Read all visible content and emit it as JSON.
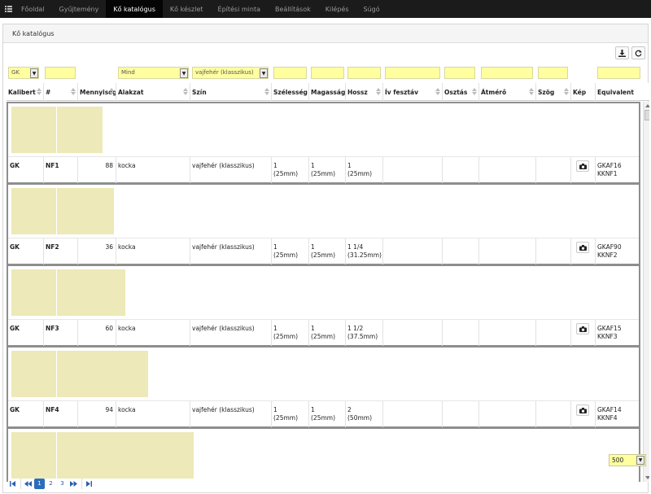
{
  "nav": {
    "items": [
      {
        "label": "Főoldal",
        "active": false
      },
      {
        "label": "Gyűjtemény",
        "active": false
      },
      {
        "label": "Kő katalógus",
        "active": true
      },
      {
        "label": "Kő készlet",
        "active": false
      },
      {
        "label": "Építési minta",
        "active": false
      },
      {
        "label": "Beállítások",
        "active": false
      },
      {
        "label": "Kilépés",
        "active": false
      },
      {
        "label": "Súgó",
        "active": false
      }
    ]
  },
  "panel": {
    "title": "Kő katalógus"
  },
  "filters": {
    "kalibert": "GK",
    "alakzat": "Mind",
    "szin": "vajfehér (klasszikus)"
  },
  "columns": [
    "Kalibert",
    "#",
    "Mennyiség",
    "Alakzat",
    "Szín",
    "Szélesség",
    "Magasság",
    "Hossz",
    "Ív fesztáv",
    "Osztás",
    "Átmérő",
    "Szög",
    "Kép",
    "Equivalent"
  ],
  "rows": [
    {
      "kalibert": "GK",
      "num": "NF1",
      "qty": "88",
      "shape": "kocka",
      "color": "vajfehér (klasszikus)",
      "width_a": "1",
      "width_b": "(25mm)",
      "height_a": "1",
      "height_b": "(25mm)",
      "length_a": "1",
      "length_b": "(25mm)",
      "eq_a": "GKAF16",
      "eq_b": "KKNF1",
      "length_units": 1
    },
    {
      "kalibert": "GK",
      "num": "NF2",
      "qty": "36",
      "shape": "kocka",
      "color": "vajfehér (klasszikus)",
      "width_a": "1",
      "width_b": "(25mm)",
      "height_a": "1",
      "height_b": "(25mm)",
      "length_a": "1 1/4",
      "length_b": "(31.25mm)",
      "eq_a": "GKAF90",
      "eq_b": "KKNF2",
      "length_units": 1.25
    },
    {
      "kalibert": "GK",
      "num": "NF3",
      "qty": "60",
      "shape": "kocka",
      "color": "vajfehér (klasszikus)",
      "width_a": "1",
      "width_b": "(25mm)",
      "height_a": "1",
      "height_b": "(25mm)",
      "length_a": "1 1/2",
      "length_b": "(37.5mm)",
      "eq_a": "GKAF15",
      "eq_b": "KKNF3",
      "length_units": 1.5
    },
    {
      "kalibert": "GK",
      "num": "NF4",
      "qty": "94",
      "shape": "kocka",
      "color": "vajfehér (klasszikus)",
      "width_a": "1",
      "width_b": "(25mm)",
      "height_a": "1",
      "height_b": "(25mm)",
      "length_a": "2",
      "length_b": "(50mm)",
      "eq_a": "GKAF14",
      "eq_b": "KKNF4",
      "length_units": 2
    },
    {
      "length_units": 3
    }
  ],
  "pager": {
    "pages": [
      "1",
      "2",
      "3"
    ],
    "current": "1",
    "page_size": "500"
  },
  "colors": {
    "filter_bg": "#ffffa0",
    "brick": "#ede9b8",
    "active_page": "#2a6ebd",
    "nav_bg": "#1b1b1b"
  },
  "icons": {
    "menu": "list-icon",
    "download": "download-icon",
    "refresh": "refresh-icon",
    "photo": "camera-icon"
  }
}
